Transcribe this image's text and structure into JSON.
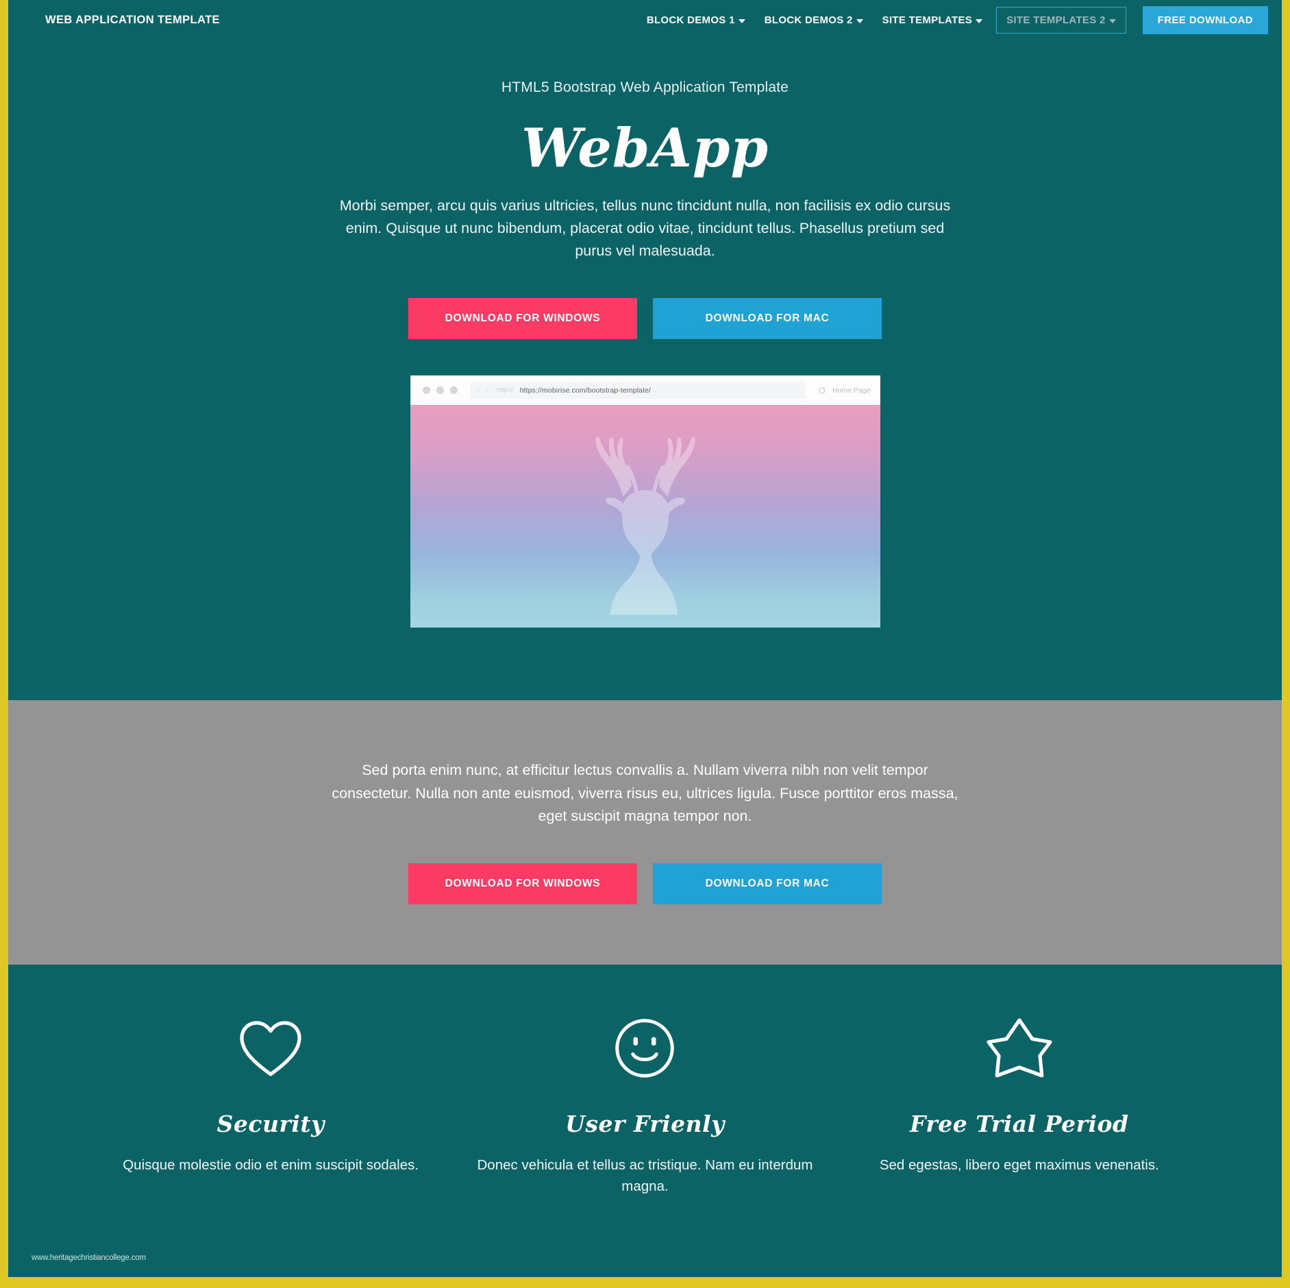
{
  "colors": {
    "teal": "#0B6366",
    "yellow_border": "#E0C822",
    "gray_band": "#949494",
    "pink_button": "#FB3B64",
    "blue_button": "#20A3D4",
    "nav_cta": "#2BA6D9",
    "focus_outline": "#2FA9D4"
  },
  "navbar": {
    "brand": "WEB APPLICATION TEMPLATE",
    "items": [
      {
        "label": "BLOCK DEMOS 1",
        "has_caret": true,
        "focused": false
      },
      {
        "label": "BLOCK DEMOS 2",
        "has_caret": true,
        "focused": false
      },
      {
        "label": "SITE TEMPLATES",
        "has_caret": true,
        "focused": false
      },
      {
        "label": "SITE TEMPLATES 2",
        "has_caret": true,
        "focused": true
      }
    ],
    "cta_label": "FREE DOWNLOAD"
  },
  "hero": {
    "kicker": "HTML5 Bootstrap Web Application Template",
    "title": "WebApp",
    "paragraph": "Morbi semper, arcu quis varius ultricies, tellus nunc tincidunt nulla, non facilisis ex odio cursus enim. Quisque ut nunc bibendum, placerat odio vitae, tincidunt tellus. Phasellus pretium sed purus vel malesuada.",
    "buttons": {
      "windows": "DOWNLOAD FOR WINDOWS",
      "mac": "DOWNLOAD FOR MAC"
    }
  },
  "browser_mockup": {
    "protocol_hint": "http://",
    "url": "https://mobirise.com/bootstrap-template/",
    "tab_label": "Home Page",
    "screen_subject": "deer-silhouette"
  },
  "gray_section": {
    "paragraph": "Sed porta enim nunc, at efficitur lectus convallis a. Nullam viverra nibh non velit tempor consectetur. Nulla non ante euismod, viverra risus eu, ultrices ligula. Fusce porttitor eros massa, eget suscipit magna tempor non.",
    "buttons": {
      "windows": "DOWNLOAD FOR WINDOWS",
      "mac": "DOWNLOAD FOR MAC"
    }
  },
  "features": [
    {
      "icon": "heart-icon",
      "title": "Security",
      "text": "Quisque molestie odio et enim suscipit sodales."
    },
    {
      "icon": "smiley-icon",
      "title": "User Frienly",
      "text": "Donec vehicula et tellus ac tristique. Nam eu interdum magna."
    },
    {
      "icon": "star-icon",
      "title": "Free Trial Period",
      "text": "Sed egestas, libero eget maximus venenatis."
    }
  ],
  "watermark": "www.heritagechristiancollege.com"
}
